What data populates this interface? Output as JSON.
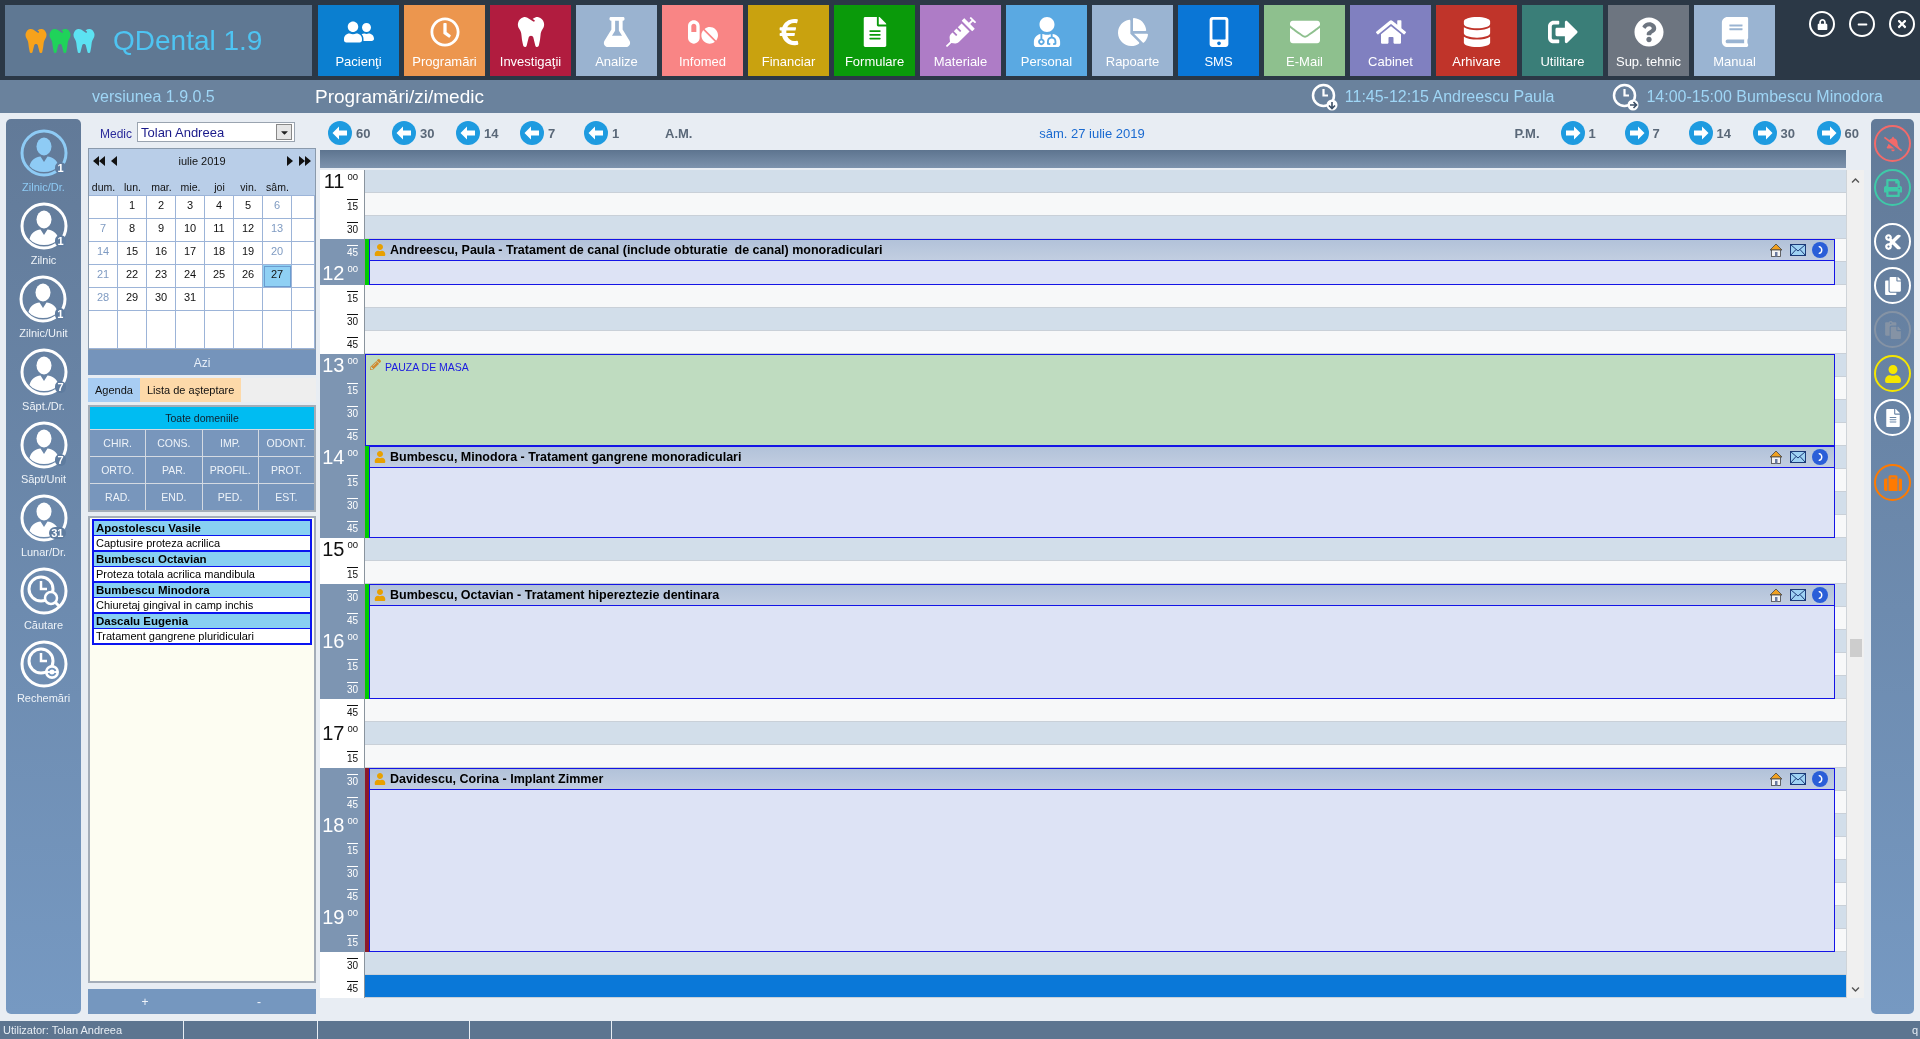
{
  "app": {
    "name": "QDental 1.9",
    "version": "versiunea 1.9.0.5",
    "page_title": "Programări/zi/medic"
  },
  "modules": [
    {
      "label": "Pacienţi",
      "color": "#0b7fd0"
    },
    {
      "label": "Programări",
      "color": "#ec964e"
    },
    {
      "label": "Investigaţii",
      "color": "#b11c3f"
    },
    {
      "label": "Analize",
      "color": "#9ab3d0"
    },
    {
      "label": "Infomed",
      "color": "#f98585"
    },
    {
      "label": "Financiar",
      "color": "#c9a20f"
    },
    {
      "label": "Formulare",
      "color": "#0a9a0a"
    },
    {
      "label": "Materiale",
      "color": "#ae7cc6"
    },
    {
      "label": "Personal",
      "color": "#5aa9e2"
    },
    {
      "label": "Rapoarte",
      "color": "#9ab4d2"
    },
    {
      "label": "SMS",
      "color": "#0a76d6"
    },
    {
      "label": "E-Mail",
      "color": "#8ec08e"
    },
    {
      "label": "Cabinet",
      "color": "#8080c0"
    },
    {
      "label": "Arhivare",
      "color": "#c0342a"
    },
    {
      "label": "Utilitare",
      "color": "#3a7e78"
    },
    {
      "label": "Sup. tehnic",
      "color": "#6d7580"
    },
    {
      "label": "Manual",
      "color": "#9ab4d2"
    }
  ],
  "reminders": [
    {
      "kind": "past",
      "text": "11:45-12:15 Andreescu Paula"
    },
    {
      "kind": "next",
      "text": "14:00-15:00 Bumbescu Minodora"
    }
  ],
  "views": [
    {
      "kind": "person",
      "label": "Zilnic/Dr.",
      "badge": "1",
      "selected": true
    },
    {
      "kind": "person",
      "label": "Zilnic",
      "badge": "1",
      "selected": false
    },
    {
      "kind": "person",
      "label": "Zilnic/Unit",
      "badge": "1",
      "selected": false
    },
    {
      "kind": "person",
      "label": "Săpt./Dr.",
      "badge": "7",
      "selected": false
    },
    {
      "kind": "person",
      "label": "Săpt/Unit",
      "badge": "7",
      "selected": false
    },
    {
      "kind": "person",
      "label": "Lunar/Dr.",
      "badge": "31",
      "selected": false
    },
    {
      "kind": "search",
      "label": "Căutare",
      "selected": false
    },
    {
      "kind": "recall",
      "label": "Rechemări",
      "selected": false
    }
  ],
  "medic": {
    "label": "Medic",
    "value": "Tolan Andreea"
  },
  "mini_calendar": {
    "title": "iulie 2019",
    "weekdays": [
      "dum.",
      "lun.",
      "mar.",
      "mie.",
      "joi",
      "vin.",
      "sâm."
    ],
    "weeks": [
      [
        {
          "day": "1",
          "weekend": false,
          "selected": false
        },
        {
          "day": "2",
          "weekend": false,
          "selected": false
        },
        {
          "day": "3",
          "weekend": false,
          "selected": false
        },
        {
          "day": "4",
          "weekend": false,
          "selected": false
        },
        {
          "day": "5",
          "weekend": false,
          "selected": false
        },
        {
          "day": "6",
          "weekend": true,
          "selected": false
        }
      ],
      [
        {
          "day": "7",
          "weekend": true,
          "selected": false
        },
        {
          "day": "8",
          "weekend": false,
          "selected": false
        },
        {
          "day": "9",
          "weekend": false,
          "selected": false
        },
        {
          "day": "10",
          "weekend": false,
          "selected": false
        },
        {
          "day": "11",
          "weekend": false,
          "selected": false
        },
        {
          "day": "12",
          "weekend": false,
          "selected": false
        },
        {
          "day": "13",
          "weekend": true,
          "selected": false
        }
      ],
      [
        {
          "day": "14",
          "weekend": true,
          "selected": false
        },
        {
          "day": "15",
          "weekend": false,
          "selected": false
        },
        {
          "day": "16",
          "weekend": false,
          "selected": false
        },
        {
          "day": "17",
          "weekend": false,
          "selected": false
        },
        {
          "day": "18",
          "weekend": false,
          "selected": false
        },
        {
          "day": "19",
          "weekend": false,
          "selected": false
        },
        {
          "day": "20",
          "weekend": true,
          "selected": false
        }
      ],
      [
        {
          "day": "21",
          "weekend": true,
          "selected": false
        },
        {
          "day": "22",
          "weekend": false,
          "selected": false
        },
        {
          "day": "23",
          "weekend": false,
          "selected": false
        },
        {
          "day": "24",
          "weekend": false,
          "selected": false
        },
        {
          "day": "25",
          "weekend": false,
          "selected": false
        },
        {
          "day": "26",
          "weekend": false,
          "selected": false
        },
        {
          "day": "27",
          "weekend": true,
          "selected": true
        }
      ],
      [
        {
          "day": "28",
          "weekend": true,
          "selected": false
        },
        {
          "day": "29",
          "weekend": false,
          "selected": false
        },
        {
          "day": "30",
          "weekend": false,
          "selected": false
        },
        {
          "day": "31",
          "weekend": false,
          "selected": false
        }
      ]
    ],
    "today_button": "Azi"
  },
  "side_tabs": [
    {
      "label": "Agenda",
      "selected": true
    },
    {
      "label": "Lista de aşteptare",
      "selected": false
    }
  ],
  "domain_filter": {
    "all": {
      "label": "Toate domeniile",
      "selected": true
    },
    "domains": [
      {
        "label": "CHIR.",
        "selected": false
      },
      {
        "label": "CONS.",
        "selected": false
      },
      {
        "label": "IMP.",
        "selected": false
      },
      {
        "label": "ODONT.",
        "selected": false
      },
      {
        "label": "ORTO.",
        "selected": false
      },
      {
        "label": "PAR.",
        "selected": false
      },
      {
        "label": "PROFIL.",
        "selected": false
      },
      {
        "label": "PROT.",
        "selected": false
      },
      {
        "label": "RAD.",
        "selected": false
      },
      {
        "label": "END.",
        "selected": false
      },
      {
        "label": "PED.",
        "selected": false
      },
      {
        "label": "EST.",
        "selected": false
      }
    ]
  },
  "waiting_list": [
    {
      "patient": "Apostolescu Vasile",
      "procedure": "Captusire proteza acrilica"
    },
    {
      "patient": "Bumbescu Octavian",
      "procedure": "Proteza totala acrilica mandibula"
    },
    {
      "patient": "Bumbescu Minodora",
      "procedure": "Chiuretaj gingival in camp inchis"
    },
    {
      "patient": "Dascalu Eugenia",
      "procedure": "Tratament gangrene pluridiculari"
    }
  ],
  "list_buttons": [
    "+",
    "-"
  ],
  "schedule": {
    "back": [
      "60",
      "30",
      "14",
      "7",
      "1"
    ],
    "am": "A.M.",
    "date": "sâm. 27 iulie 2019",
    "pm": "P.M.",
    "forward": [
      "1",
      "7",
      "14",
      "30",
      "60"
    ],
    "hours": [
      {
        "hour": "11",
        "slots": [
          {
            "minute": "00",
            "kind": "free",
            "selected": false
          },
          {
            "minute": "15",
            "kind": "free",
            "selected": false
          },
          {
            "minute": "30",
            "kind": "free",
            "selected": false
          },
          {
            "minute": "45",
            "kind": "booked",
            "selected": false,
            "appointment": {
              "kind": "patient",
              "title": "Andreescu, Paula - Tratament de canal (include obturatie  de canal) monoradiculari",
              "color": "#00cc00"
            }
          }
        ]
      },
      {
        "hour": "12",
        "slots": [
          {
            "minute": "00",
            "kind": "booked",
            "selected": false
          },
          {
            "minute": "15",
            "kind": "free",
            "selected": false
          },
          {
            "minute": "30",
            "kind": "free",
            "selected": false
          },
          {
            "minute": "45",
            "kind": "free",
            "selected": false
          }
        ]
      },
      {
        "hour": "13",
        "slots": [
          {
            "minute": "00",
            "kind": "booked",
            "selected": false,
            "appointment": {
              "kind": "break",
              "title": "PAUZA DE MASA"
            }
          },
          {
            "minute": "15",
            "kind": "booked",
            "selected": false
          },
          {
            "minute": "30",
            "kind": "booked",
            "selected": false
          },
          {
            "minute": "45",
            "kind": "booked",
            "selected": false
          }
        ]
      },
      {
        "hour": "14",
        "slots": [
          {
            "minute": "00",
            "kind": "booked",
            "selected": false,
            "appointment": {
              "kind": "patient",
              "title": "Bumbescu, Minodora - Tratament gangrene monoradiculari",
              "color": "#00cc00"
            }
          },
          {
            "minute": "15",
            "kind": "booked",
            "selected": false
          },
          {
            "minute": "30",
            "kind": "booked",
            "selected": false
          },
          {
            "minute": "45",
            "kind": "booked",
            "selected": false
          }
        ]
      },
      {
        "hour": "15",
        "slots": [
          {
            "minute": "00",
            "kind": "free",
            "selected": false
          },
          {
            "minute": "15",
            "kind": "free",
            "selected": false
          },
          {
            "minute": "30",
            "kind": "booked",
            "selected": false,
            "appointment": {
              "kind": "patient",
              "title": "Bumbescu, Octavian - Tratament hipereztezie dentinara",
              "color": "#00cc00"
            }
          },
          {
            "minute": "45",
            "kind": "booked",
            "selected": false
          }
        ]
      },
      {
        "hour": "16",
        "slots": [
          {
            "minute": "00",
            "kind": "booked",
            "selected": false
          },
          {
            "minute": "15",
            "kind": "booked",
            "selected": false
          },
          {
            "minute": "30",
            "kind": "booked",
            "selected": false
          },
          {
            "minute": "45",
            "kind": "free",
            "selected": false
          }
        ]
      },
      {
        "hour": "17",
        "slots": [
          {
            "minute": "00",
            "kind": "free",
            "selected": false
          },
          {
            "minute": "15",
            "kind": "free",
            "selected": false
          },
          {
            "minute": "30",
            "kind": "booked",
            "selected": false,
            "appointment": {
              "kind": "patient",
              "title": "Davidescu, Corina - Implant Zimmer",
              "color": "#8b1a2a"
            }
          },
          {
            "minute": "45",
            "kind": "booked",
            "selected": false
          }
        ]
      },
      {
        "hour": "18",
        "slots": [
          {
            "minute": "00",
            "kind": "booked",
            "selected": false
          },
          {
            "minute": "15",
            "kind": "booked",
            "selected": false
          },
          {
            "minute": "30",
            "kind": "booked",
            "selected": false
          },
          {
            "minute": "45",
            "kind": "booked",
            "selected": false
          }
        ]
      },
      {
        "hour": "19",
        "slots": [
          {
            "minute": "00",
            "kind": "booked",
            "selected": false
          },
          {
            "minute": "15",
            "kind": "booked",
            "selected": false
          },
          {
            "minute": "30",
            "kind": "free",
            "selected": false
          },
          {
            "minute": "45",
            "kind": "free",
            "selected": true
          }
        ]
      }
    ]
  },
  "tool_groups": [
    {
      "tools": [
        {
          "disabled": false
        },
        {
          "disabled": false
        }
      ]
    },
    {
      "tools": [
        {
          "disabled": false
        },
        {
          "disabled": false
        },
        {
          "disabled": true
        },
        {
          "disabled": false
        },
        {
          "disabled": false
        }
      ]
    },
    {
      "tools": [
        {
          "disabled": false
        }
      ]
    }
  ],
  "status_bar": {
    "user": "Utilizator: Tolan Andreea",
    "trailing": "q"
  }
}
